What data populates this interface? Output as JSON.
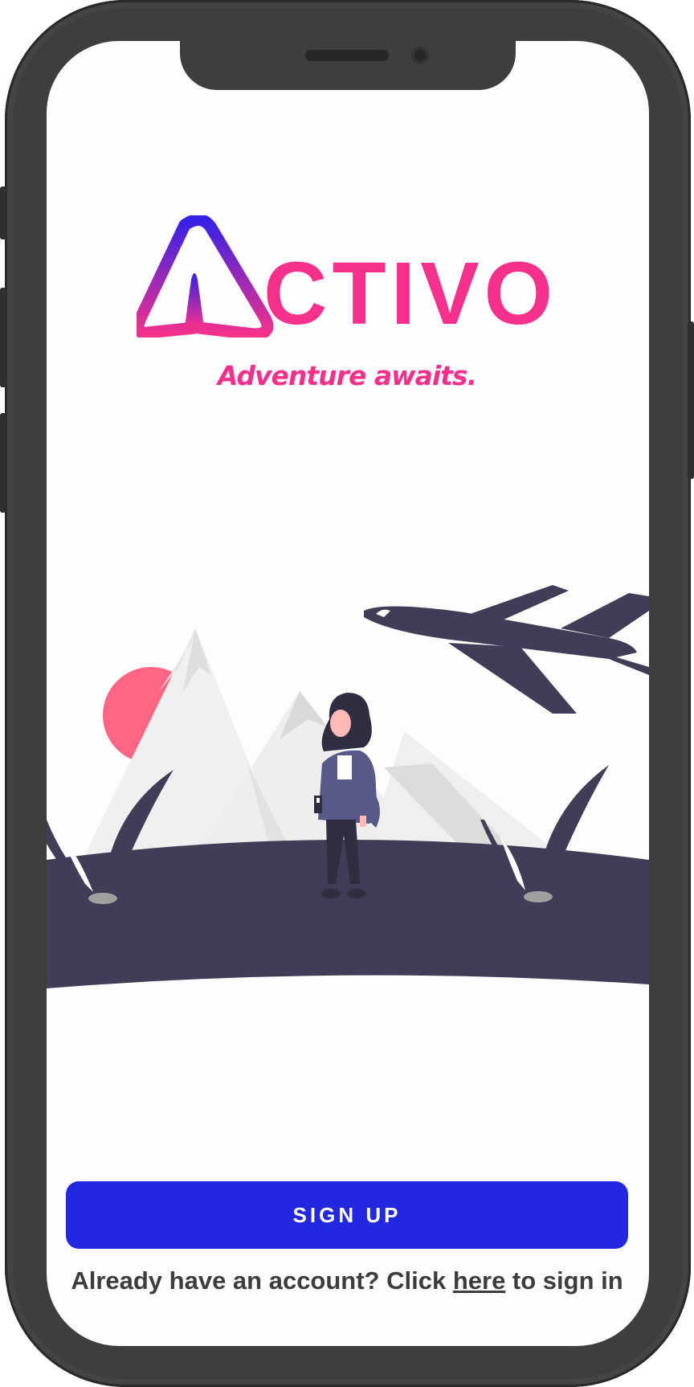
{
  "app": {
    "logo_text": "ACTIVO",
    "tagline": "Adventure awaits."
  },
  "actions": {
    "signup_label": "SIGN UP",
    "signin_prefix": "Already have an account? Click ",
    "signin_link": "here",
    "signin_suffix": " to sign in"
  },
  "colors": {
    "brand_pink": "#f5318c",
    "brand_blue": "#2128e0",
    "logo_gradient_top": "#3422e6",
    "text_dark": "#3d3d3d",
    "illustration_dark": "#403e56",
    "sun": "#ff6584"
  },
  "icons": {
    "logo_mark": "tent-triangle-icon",
    "illustration": "traveler-mountains-airplane"
  }
}
